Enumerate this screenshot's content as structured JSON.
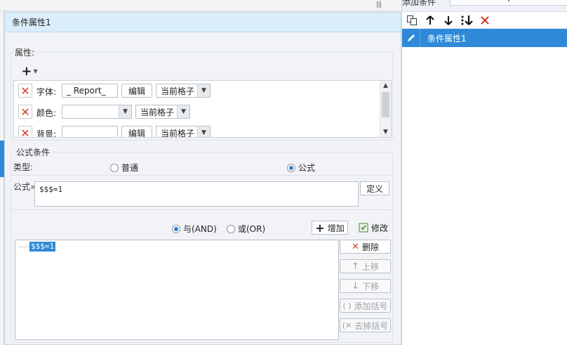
{
  "right_panel": {
    "title": "添加条件",
    "add_label": "+",
    "items": [
      {
        "label": "条件属性1"
      }
    ]
  },
  "dialog": {
    "title": "条件属性1",
    "attributes": {
      "label": "属性:",
      "add_button": "+",
      "rows": [
        {
          "name": "字体:",
          "value": "_ Report_",
          "edit": "编辑",
          "scope": "当前格子"
        },
        {
          "name": "颜色:",
          "value": "",
          "scope": "当前格子"
        },
        {
          "name": "背景:",
          "value": "",
          "edit": "编辑",
          "scope": "当前格子"
        }
      ]
    },
    "formula_condition": {
      "label": "公式条件",
      "type_label": "类型:",
      "type_normal": "普通",
      "type_formula": "公式",
      "formula_label": "公式=",
      "formula_value": "$$$=1",
      "define_button": "定义",
      "and_label": "与(AND)",
      "or_label": "或(OR)",
      "add_button": "增加",
      "modify_button": "修改",
      "tree_node": "$$$=1",
      "delete_button": "删除",
      "up_button": "上移",
      "down_button": "下移",
      "add_bracket_button": "添加括号",
      "remove_bracket_button": "去掉括号"
    }
  },
  "colors": {
    "accent": "#2e8ad8",
    "delete": "#d83a2e",
    "title_bar": "#d9eefa"
  }
}
